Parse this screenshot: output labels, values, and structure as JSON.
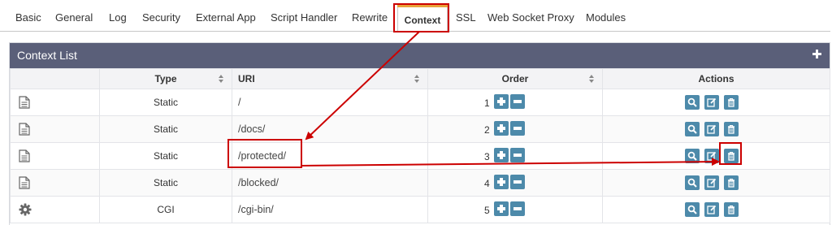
{
  "tabs": [
    {
      "label": "Basic"
    },
    {
      "label": "General"
    },
    {
      "label": "Log"
    },
    {
      "label": "Security"
    },
    {
      "label": "External App"
    },
    {
      "label": "Script Handler"
    },
    {
      "label": "Rewrite"
    },
    {
      "label": "Context",
      "active": true
    },
    {
      "label": "SSL"
    },
    {
      "label": "Web Socket Proxy"
    },
    {
      "label": "Modules"
    }
  ],
  "panel": {
    "title": "Context List",
    "add_icon": "plus-icon"
  },
  "table": {
    "columns": [
      "",
      "Type",
      "URI",
      "Order",
      "Actions"
    ],
    "rows": [
      {
        "icon": "file-icon",
        "type": "Static",
        "uri": "/",
        "order": "1"
      },
      {
        "icon": "file-icon",
        "type": "Static",
        "uri": "/docs/",
        "order": "2"
      },
      {
        "icon": "file-icon",
        "type": "Static",
        "uri": "/protected/",
        "order": "3"
      },
      {
        "icon": "file-icon",
        "type": "Static",
        "uri": "/blocked/",
        "order": "4"
      },
      {
        "icon": "gear-icon",
        "type": "CGI",
        "uri": "/cgi-bin/",
        "order": "5"
      }
    ],
    "action_icons": [
      "view-icon",
      "edit-icon",
      "delete-icon"
    ]
  },
  "colors": {
    "header_bg": "#5a5f79",
    "button_bg": "#4d8aaa",
    "active_tab_accent": "#e8a33a",
    "annotation": "#cc0000"
  }
}
